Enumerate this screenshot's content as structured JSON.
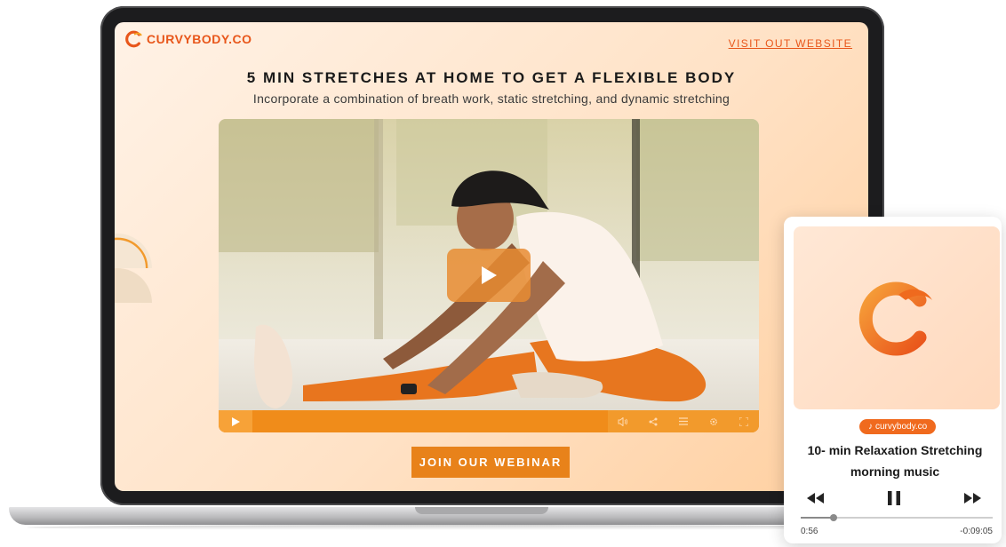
{
  "brand": {
    "name": "CURVYBODY.CO",
    "accent": "#e8561a"
  },
  "header": {
    "visit_link": "VISIT OUT WEBSITE"
  },
  "hero": {
    "title": "5 MIN STRETCHES AT HOME TO GET A FLEXIBLE BODY",
    "subtitle": "Incorporate a combination of breath work, static stretching, and dynamic stretching"
  },
  "video": {
    "controls": [
      "play-icon",
      "volume-icon",
      "share-icon",
      "playlist-icon",
      "settings-icon",
      "fullscreen-icon"
    ],
    "control_color": "#f08c1a"
  },
  "cta": {
    "label": "JOIN OUR WEBINAR"
  },
  "music": {
    "source_chip": "curvybody.co",
    "title": "10- min Relaxation Stretching morning music",
    "elapsed": "0:56",
    "remaining": "-0:09:05",
    "progress": 0.17,
    "playing": true
  }
}
